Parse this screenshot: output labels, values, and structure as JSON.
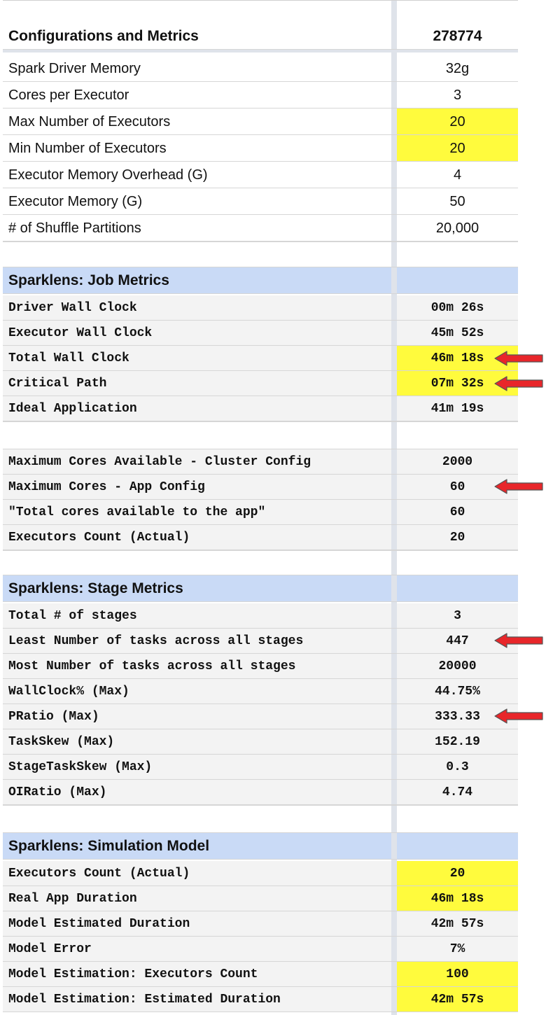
{
  "colors": {
    "highlight": "#fffb3d",
    "section_header_bg": "#c9daf6",
    "mono_row_bg": "#f3f3f3",
    "arrow_fill": "#e8262a"
  },
  "config": {
    "title": "Configurations and Metrics",
    "id": "278774",
    "rows": [
      {
        "label": "Spark Driver Memory",
        "value": "32g"
      },
      {
        "label": "Cores per Executor",
        "value": "3"
      },
      {
        "label": "Max Number of Executors",
        "value": "20"
      },
      {
        "label": "Min Number of Executors",
        "value": "20"
      },
      {
        "label": "Executor Memory Overhead (G)",
        "value": "4"
      },
      {
        "label": "Executor Memory (G)",
        "value": "50"
      },
      {
        "label": "# of Shuffle Partitions",
        "value": "20,000"
      }
    ]
  },
  "job": {
    "title": "Sparklens: Job Metrics",
    "rows": [
      {
        "label": "Driver Wall Clock",
        "value": "00m 26s"
      },
      {
        "label": "Executor Wall Clock",
        "value": "45m 52s"
      },
      {
        "label": "Total Wall Clock",
        "value": "46m 18s"
      },
      {
        "label": "Critical Path",
        "value": "07m 32s"
      },
      {
        "label": "Ideal Application",
        "value": "41m 19s"
      }
    ],
    "rows2": [
      {
        "label": "Maximum Cores Available - Cluster Config",
        "value": "2000"
      },
      {
        "label": "Maximum Cores - App Config",
        "value": "60"
      },
      {
        "label": "\"Total cores available to the app\"",
        "value": "60"
      },
      {
        "label": "Executors Count (Actual)",
        "value": "20"
      }
    ]
  },
  "stage": {
    "title": "Sparklens: Stage Metrics",
    "rows": [
      {
        "label": "Total # of stages",
        "value": "3"
      },
      {
        "label": "Least Number of tasks across all stages",
        "value": "447"
      },
      {
        "label": "Most Number of tasks across all stages",
        "value": "20000"
      },
      {
        "label": "WallClock% (Max)",
        "value": "44.75%"
      },
      {
        "label": "PRatio (Max)",
        "value": "333.33"
      },
      {
        "label": "TaskSkew (Max)",
        "value": "152.19"
      },
      {
        "label": "StageTaskSkew (Max)",
        "value": "0.3"
      },
      {
        "label": "OIRatio (Max)",
        "value": "4.74"
      }
    ]
  },
  "sim": {
    "title": "Sparklens: Simulation Model",
    "rows": [
      {
        "label": "Executors Count (Actual)",
        "value": "20"
      },
      {
        "label": "Real App Duration",
        "value": "46m 18s"
      },
      {
        "label": "Model Estimated Duration",
        "value": "42m 57s"
      },
      {
        "label": "Model Error",
        "value": "7%"
      },
      {
        "label": "Model Estimation: Executors Count",
        "value": "100"
      },
      {
        "label": "Model Estimation: Estimated Duration",
        "value": "42m 57s"
      }
    ]
  }
}
